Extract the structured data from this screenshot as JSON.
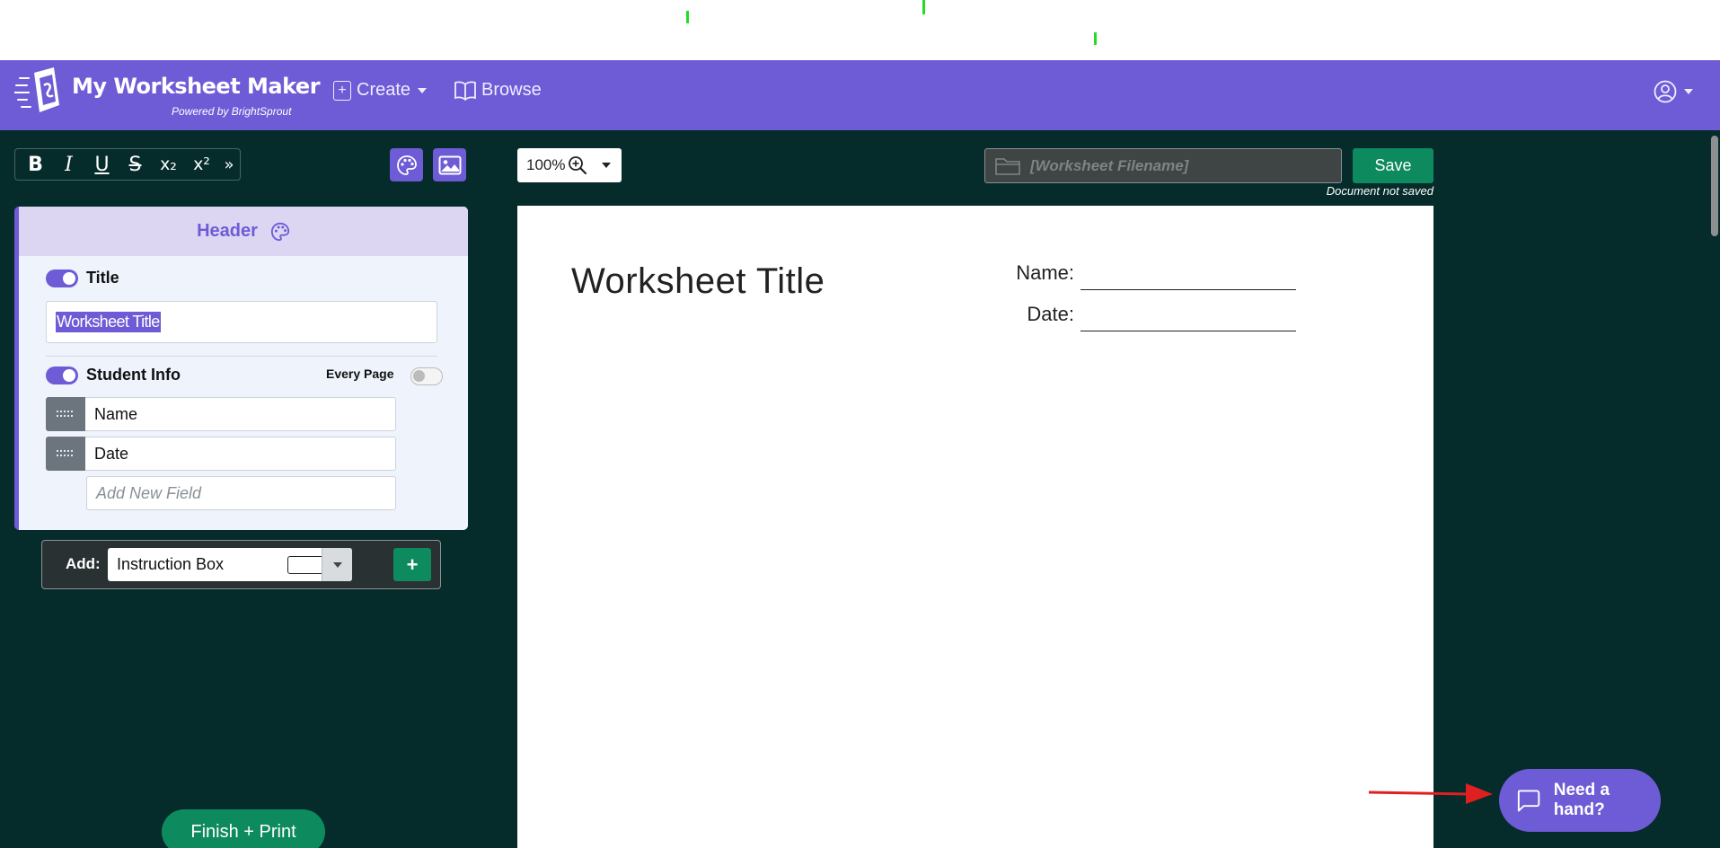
{
  "app": {
    "title": "My Worksheet Maker",
    "subtitle": "Powered by BrightSprout",
    "brand_color": "#6e5bd6",
    "dark_bg": "#062b2b",
    "success_color": "#0e8a5f"
  },
  "nav": {
    "create_label": "Create",
    "browse_label": "Browse",
    "user_icon": "user-circle-icon"
  },
  "format_toolbar": {
    "bold": "B",
    "italic": "I",
    "underline": "U",
    "strikethrough": "S",
    "subscript": "x₂",
    "superscript": "x²",
    "more": "»"
  },
  "header_panel": {
    "heading": "Header",
    "title_toggle_label": "Title",
    "title_toggle_on": true,
    "title_value": "Worksheet Title",
    "student_info_label": "Student Info",
    "student_info_on": true,
    "every_page_label": "Every Page",
    "every_page_on": false,
    "fields": [
      "Name",
      "Date"
    ],
    "new_field_placeholder": "Add New Field"
  },
  "add_bar": {
    "label": "Add:",
    "selected": "Instruction Box",
    "plus": "+"
  },
  "finish_label": "Finish + Print",
  "zoom": {
    "level": "100%"
  },
  "file": {
    "filename_placeholder": "[Worksheet Filename]",
    "save_label": "Save",
    "status": "Document not saved"
  },
  "worksheet": {
    "title": "Worksheet Title",
    "name_label": "Name:",
    "date_label": "Date:"
  },
  "help": {
    "label": "Need a hand?"
  }
}
